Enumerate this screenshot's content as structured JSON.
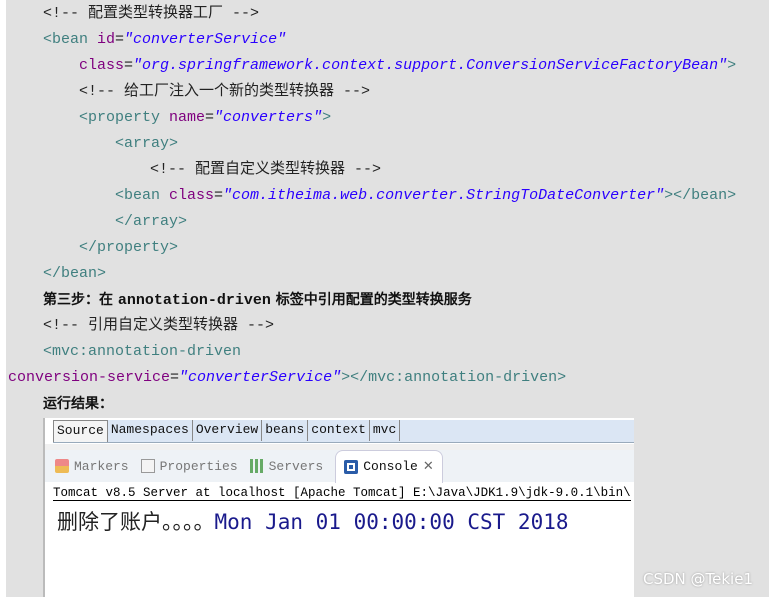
{
  "code": {
    "l1": [
      "<!-- 配置类型转换器工厂 -->"
    ],
    "l2": [
      "<bean ",
      "id",
      "=",
      "\"converterService\""
    ],
    "l3": [
      "class",
      "=",
      "\"org.springframework.context.support.ConversionServiceFactoryBean\"",
      ">"
    ],
    "l4": [
      "<!-- 给工厂注入一个新的类型转换器 -->"
    ],
    "l5": [
      "<property ",
      "name",
      "=",
      "\"converters\"",
      ">"
    ],
    "l6": [
      "<array>"
    ],
    "l7": [
      "<!-- 配置自定义类型转换器 -->"
    ],
    "l8": [
      "<bean ",
      "class",
      "=",
      "\"com.itheima.web.converter.StringToDateConverter\"",
      "></bean>"
    ],
    "l9": [
      "</array>"
    ],
    "l10": [
      "</property>"
    ],
    "l11": [
      "</bean>"
    ],
    "step3": [
      "第三步：在 ",
      "annotation-driven",
      " 标签中引用配置的类型转换服务"
    ],
    "l13": [
      "<!-- 引用自定义类型转换器 -->"
    ],
    "l14": [
      "<mvc:annotation-driven"
    ],
    "l15": [
      "conversion-service",
      "=",
      "\"converterService\"",
      "></mvc:annotation-driven>"
    ],
    "result_label": "运行结果："
  },
  "colors": {
    "tag": "#3f7f7f",
    "attribute": "#7f007f",
    "value": "#2a00ff"
  },
  "screenshot": {
    "editor_tabs": [
      "Source",
      "Namespaces",
      "Overview",
      "beans",
      "context",
      "mvc"
    ],
    "active_editor_tab": "Source",
    "view_tabs": [
      {
        "label": "Markers",
        "icon": "markers-icon"
      },
      {
        "label": "Properties",
        "icon": "properties-icon"
      },
      {
        "label": "Servers",
        "icon": "servers-icon"
      },
      {
        "label": "Console",
        "icon": "console-icon",
        "close": "close-icon"
      }
    ],
    "active_view_tab": "Console",
    "console_header": "Tomcat v8.5 Server at localhost [Apache Tomcat] E:\\Java\\JDK1.9\\jdk-9.0.1\\bin\\",
    "output_cn": "删除了账户。。。。",
    "output_en": "Mon Jan 01 00:00:00 CST 2018"
  },
  "watermark": "CSDN @Tekie1"
}
